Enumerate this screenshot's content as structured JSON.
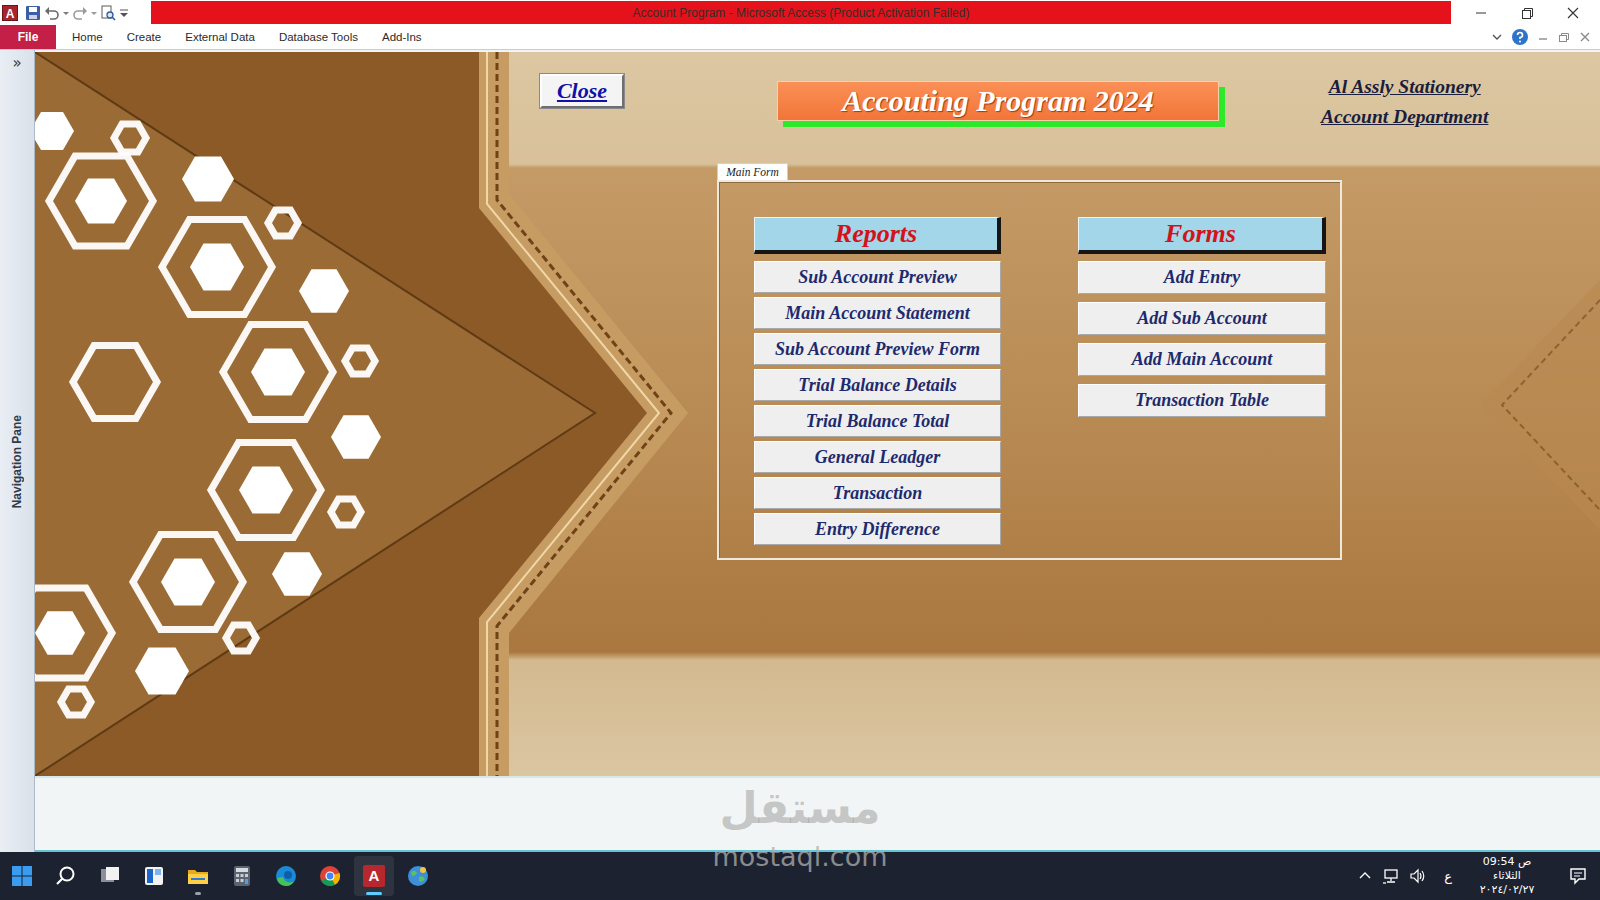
{
  "window": {
    "title": "Account Program - Microsoft Access (Product Activation Failed)",
    "logo_letter": "A"
  },
  "ribbon": {
    "file": "File",
    "tabs": [
      {
        "label": "Home",
        "selected": false
      },
      {
        "label": "Create",
        "selected": false
      },
      {
        "label": "External Data",
        "selected": false
      },
      {
        "label": "Database Tools",
        "selected": false
      },
      {
        "label": "Add-Ins",
        "selected": false
      }
    ]
  },
  "navigation_pane": {
    "toggle": "»",
    "label": "Navigation Pane",
    "expanded": false
  },
  "form": {
    "close_button": "Close",
    "title": "Accouting Program 2024",
    "company": "Al Assly Stationery",
    "department": "Account Department",
    "tab": {
      "label": "Main Form",
      "selected": true
    },
    "reports": {
      "header": "Reports",
      "items": [
        "Sub Account Preview",
        "Main Account Statement",
        "Sub Account Preview Form",
        "Trial Balance Details",
        "Trial Balance Total",
        "General Leadger",
        "Transaction",
        "Entry Difference"
      ]
    },
    "forms": {
      "header": "Forms",
      "items": [
        "Add Entry",
        "Add Sub Account",
        "Add Main Account",
        "Transaction Table"
      ]
    }
  },
  "watermark": {
    "arabic": "مستقل",
    "latin": "mostaql.com"
  },
  "taskbar": {
    "apps": [
      {
        "kind": "start",
        "active": false,
        "running": false
      },
      {
        "kind": "search",
        "active": false,
        "running": false
      },
      {
        "kind": "task-view",
        "active": false,
        "running": false
      },
      {
        "kind": "widgets",
        "active": false,
        "running": false
      },
      {
        "kind": "explorer",
        "active": false,
        "running": true
      },
      {
        "kind": "calculator",
        "active": false,
        "running": false
      },
      {
        "kind": "edge",
        "active": false,
        "running": false
      },
      {
        "kind": "chrome",
        "active": false,
        "running": false
      },
      {
        "kind": "access",
        "active": true,
        "running": true
      },
      {
        "kind": "globe",
        "active": false,
        "running": false
      }
    ],
    "tray": {
      "input_language": "ع",
      "time": "09:54 ص",
      "day": "الثلاثاء",
      "date": "٢٠٢٤/٠٢/٢٧"
    }
  }
}
